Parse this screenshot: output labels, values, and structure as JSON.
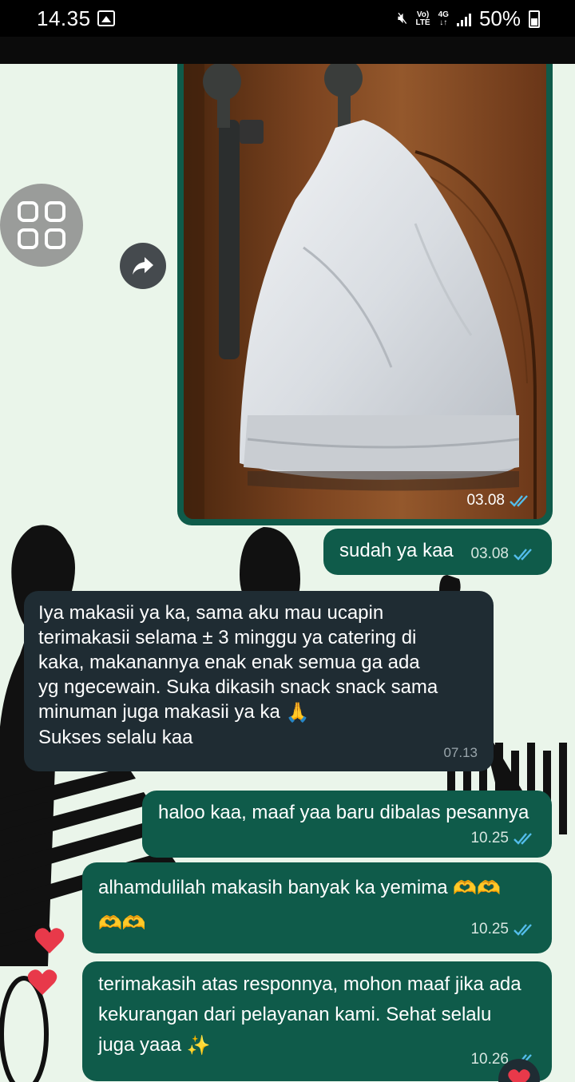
{
  "status_bar": {
    "time": "14.35",
    "network_top": "Vo)",
    "network_bottom": "LTE",
    "data_top": "4G",
    "data_bottom": "↓↑",
    "battery": "50%"
  },
  "icons": {
    "gallery": "image-icon",
    "mute": "mute-icon",
    "forward": "forward-icon",
    "menu": "app-grid-icon",
    "read": "double-check-icon",
    "reaction": "heart-icon"
  },
  "colors": {
    "outgoing_bubble": "#0f5b4a",
    "incoming_bubble": "#1f2c33",
    "read_ticks": "#53bdeb",
    "heart": "#e8394a"
  },
  "messages": [
    {
      "type": "image",
      "direction": "out",
      "time": "03.08"
    },
    {
      "direction": "out",
      "lines": [
        "sudah ya kaa"
      ],
      "time": "03.08"
    },
    {
      "direction": "in",
      "lines": [
        "Iya makasii ya ka, sama aku mau ucapin",
        "terimakasii selama ± 3 minggu ya catering di",
        "kaka, makanannya enak enak semua ga ada",
        "yg ngecewain. Suka dikasih snack snack sama",
        "minuman juga makasii ya ka",
        "Sukses selalu kaa"
      ],
      "time": "07.13"
    },
    {
      "direction": "out",
      "lines": [
        "haloo kaa, maaf yaa baru dibalas pesannya"
      ],
      "time": "10.25"
    },
    {
      "direction": "out",
      "lines": [
        "alhamdulilah makasih banyak ka yemima"
      ],
      "time": "10.25"
    },
    {
      "direction": "out",
      "lines": [
        "terimakasih atas responnya, mohon maaf jika ada",
        "kekurangan dari pelayanan kami. Sehat selalu",
        "juga yaaa"
      ],
      "time": "10.26"
    }
  ]
}
